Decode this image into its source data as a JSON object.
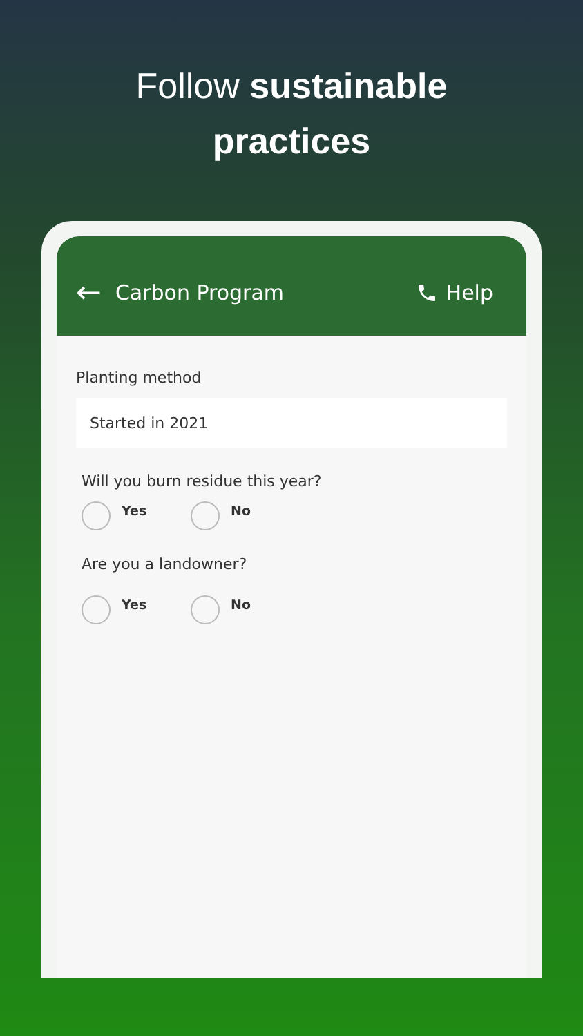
{
  "headline": "Follow **sustainable practices**",
  "app_bar": {
    "back": "←",
    "title": "Carbon Program",
    "help": "Help"
  },
  "field": {
    "label": "Planting method",
    "value": "Started in 2021"
  },
  "questions": [
    {
      "label": "Will you burn residue this year?",
      "options": [
        {
          "label": "Yes",
          "selected": false
        },
        {
          "label": "No",
          "selected": false
        }
      ]
    },
    {
      "label": "Are you a landowner?",
      "options": [
        {
          "label": "Yes",
          "selected": false
        },
        {
          "label": "No",
          "selected": false
        }
      ]
    }
  ]
}
